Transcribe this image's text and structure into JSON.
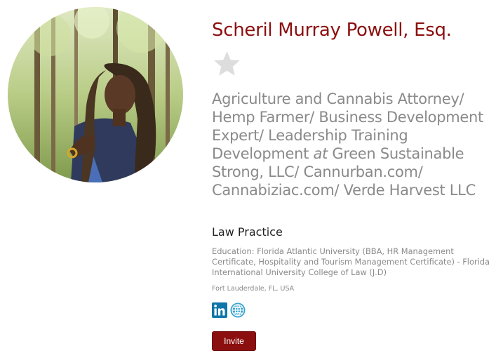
{
  "profile": {
    "name": "Scheril Murray Powell, Esq.",
    "title_part1": "Agriculture and Cannabis Attorney/ Hemp Farmer/ Business Development Expert/ Leadership Training Development ",
    "title_at": "at",
    "title_part2": " Green Sustainable Strong, LLC/ Cannurban.com/ Cannabiziac.com/ Verde Harvest LLC",
    "practice": "Law Practice",
    "education": "Education: Florida Atlantic University (BBA, HR Management Certificate, Hospitality and Tourism Management Certificate) - Florida International University College of Law (J.D)",
    "location": "Fort Lauderdale, FL, USA",
    "invite_label": "Invite"
  },
  "icons": {
    "favorite": "star-icon",
    "linkedin": "linkedin-icon",
    "website": "globe-icon"
  },
  "colors": {
    "accent": "#8b0f0f",
    "muted_text": "#8a8a8a",
    "star": "#dddddd",
    "linkedin": "#0e76a8",
    "globe": "#3aa6d0"
  }
}
